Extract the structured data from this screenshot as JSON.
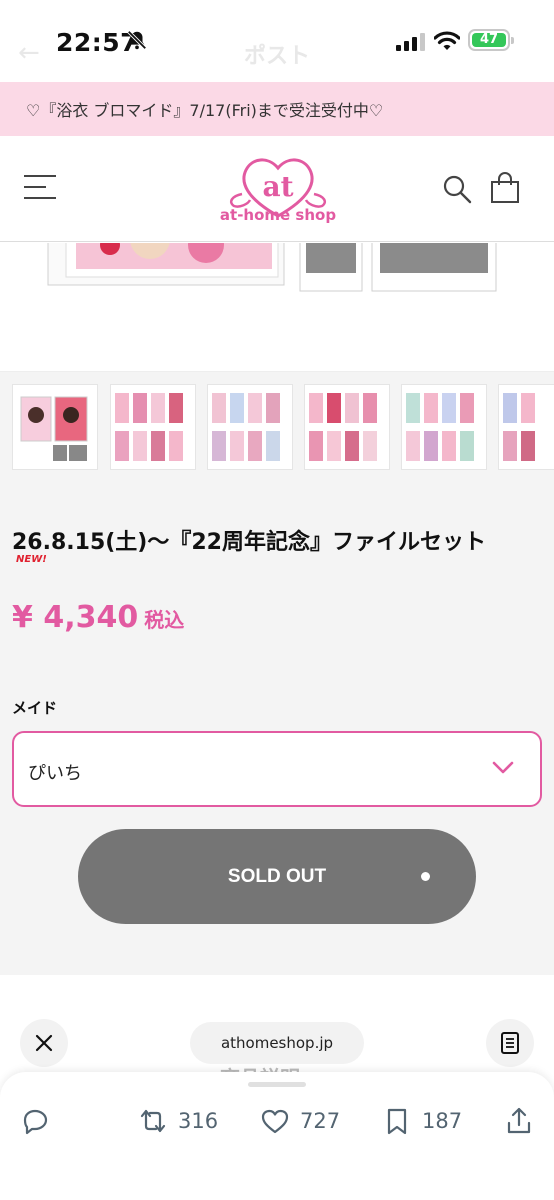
{
  "status_bar": {
    "time": "22:57",
    "battery": "47",
    "ghost_back": "←",
    "ghost_title": "ポスト"
  },
  "announcement": "♡『浴衣 ブロマイド』7/17(Fri)まで受注受付中♡",
  "header": {
    "logo_mark": "at",
    "logo_text": "at-home shop"
  },
  "product": {
    "title": "26.8.15(土)〜『22周年記念』ファイルセット",
    "badge": "NEW!",
    "price": "¥ 4,340",
    "tax_label": "税込",
    "variant_label": "メイド",
    "variant_value": "ぴいち",
    "button_label": "SOLD OUT"
  },
  "browser_bar": {
    "url": "athomeshop.jp",
    "peek_text": "商品説明"
  },
  "tweet_actions": {
    "retweets": "316",
    "likes": "727",
    "bookmarks": "187"
  },
  "colors": {
    "brand_pink": "#e25aa1",
    "announcement_bg": "#fbd9e6",
    "soldout_gray": "#757575",
    "new_red": "#e0212f"
  }
}
